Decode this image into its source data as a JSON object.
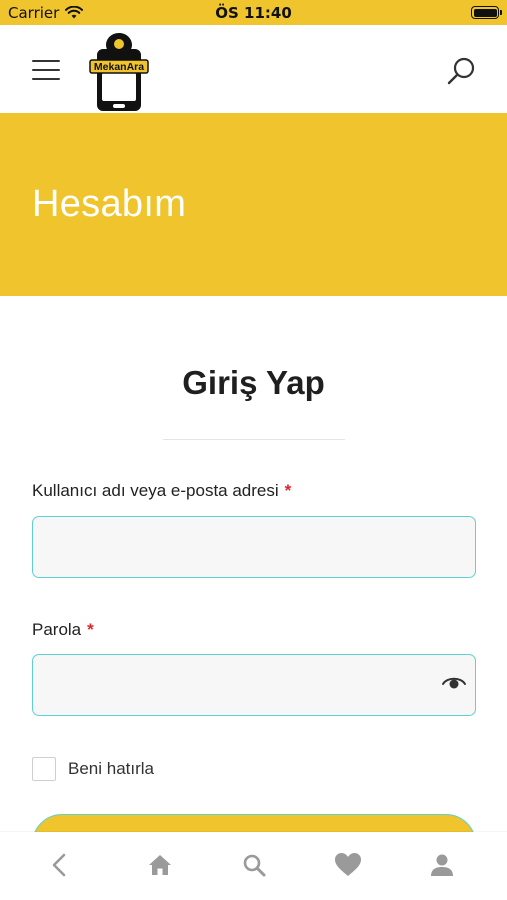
{
  "status_bar": {
    "carrier": "Carrier",
    "time": "ÖS 11:40"
  },
  "header": {
    "logo_text": "MekanAra",
    "menu_icon": "hamburger-menu-icon",
    "search_icon": "search-icon"
  },
  "hero": {
    "title": "Hesabım"
  },
  "form": {
    "title": "Giriş Yap",
    "username_label": "Kullanıcı adı veya e-posta adresi",
    "username_value": "",
    "password_label": "Parola",
    "password_value": "",
    "required_marker": "*",
    "remember_label": "Beni hatırla"
  },
  "tab_bar": {
    "items": [
      {
        "name": "back",
        "icon": "chevron-left-icon"
      },
      {
        "name": "home",
        "icon": "home-icon"
      },
      {
        "name": "search",
        "icon": "search-icon"
      },
      {
        "name": "favorites",
        "icon": "heart-icon"
      },
      {
        "name": "account",
        "icon": "user-icon"
      }
    ]
  },
  "colors": {
    "brand_yellow": "#efc42c",
    "input_border": "#5fd1cf",
    "required_red": "#e0242b",
    "tab_icon_gray": "#9a9a9a"
  }
}
